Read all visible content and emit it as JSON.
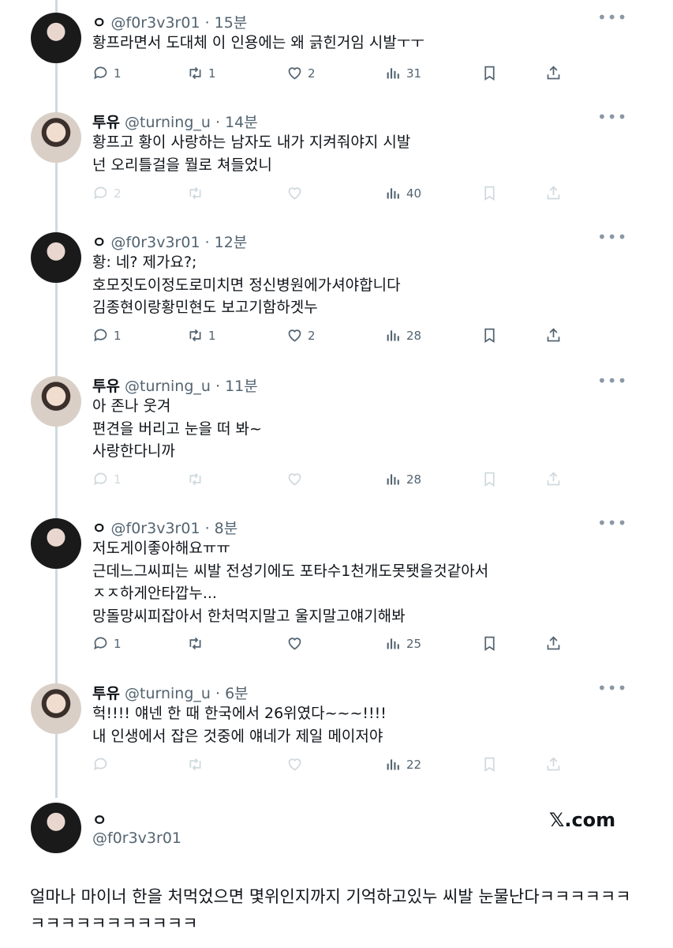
{
  "tweets": [
    {
      "name": "ㅇ",
      "handle": "@f0r3v3r01",
      "sep": "·",
      "time": "15분",
      "lines": [
        "황프라면서 도대체 이 인용에는 왜 긁힌거임 시발ㅜㅜ"
      ],
      "replies": "1",
      "retweets": "1",
      "likes": "2",
      "views": "31",
      "muted": false,
      "avatar": "dark"
    },
    {
      "name": "투유",
      "handle": "@turning_u",
      "sep": "·",
      "time": "14분",
      "lines": [
        "황프고 황이 사랑하는 남자도 내가 지켜줘야지 시발",
        "넌 오리틀걸을 뭘로 쳐들었니"
      ],
      "replies": "2",
      "retweets": "",
      "likes": "",
      "views": "40",
      "muted": true,
      "avatar": "light"
    },
    {
      "name": "ㅇ",
      "handle": "@f0r3v3r01",
      "sep": "·",
      "time": "12분",
      "lines": [
        "황: 네? 제가요?;",
        "호모짓도이정도로미치면 정신병원에가셔야합니다",
        "김종현이랑황민현도 보고기함하겟누"
      ],
      "replies": "1",
      "retweets": "1",
      "likes": "2",
      "views": "28",
      "muted": false,
      "avatar": "dark"
    },
    {
      "name": "투유",
      "handle": "@turning_u",
      "sep": "·",
      "time": "11분",
      "lines": [
        "아 존나 웃겨",
        "편견을 버리고 눈을 떠 봐~",
        "사랑한다니까"
      ],
      "replies": "1",
      "retweets": "",
      "likes": "",
      "views": "28",
      "muted": true,
      "avatar": "light"
    },
    {
      "name": "ㅇ",
      "handle": "@f0r3v3r01",
      "sep": "·",
      "time": "8분",
      "lines": [
        "저도게이좋아해요ㅠㅠ",
        "근데느그씨피는 씨발 전성기에도 포타수1천개도못됏을것같아서",
        "ㅈㅈ하게안타깝누...",
        "망돌망씨피잡아서 한처먹지말고 울지말고얘기해봐"
      ],
      "replies": "1",
      "retweets": "",
      "likes": "",
      "views": "25",
      "muted": false,
      "avatar": "dark"
    },
    {
      "name": "투유",
      "handle": "@turning_u",
      "sep": "·",
      "time": "6분",
      "lines": [
        "헉!!!! 얘넨 한 때 한국에서 26위였다~~~!!!!",
        "내 인생에서 잡은 것중에 얘네가 제일 메이저야"
      ],
      "replies": "",
      "retweets": "",
      "likes": "",
      "views": "22",
      "muted": true,
      "avatar": "light"
    }
  ],
  "main": {
    "name": "ㅇ",
    "handle": "@f0r3v3r01",
    "source": "𝕏.com",
    "text": "얼마나 마이너 한을 처먹었으면 몇위인지까지 기억하고있누 씨발 눈물난다ㅋㅋㅋㅋㅋㅋㅋㅋㅋㅋㅋㅋㅋㅋㅋㅋㅋ"
  },
  "colors": {
    "text": "#0f1419",
    "secondary": "#536471",
    "muted_icon": "#cfd9de",
    "thread_line": "#cfd9de"
  },
  "icons": [
    "reply-icon",
    "retweet-icon",
    "like-icon",
    "views-icon",
    "bookmark-icon",
    "share-icon",
    "more-icon"
  ]
}
